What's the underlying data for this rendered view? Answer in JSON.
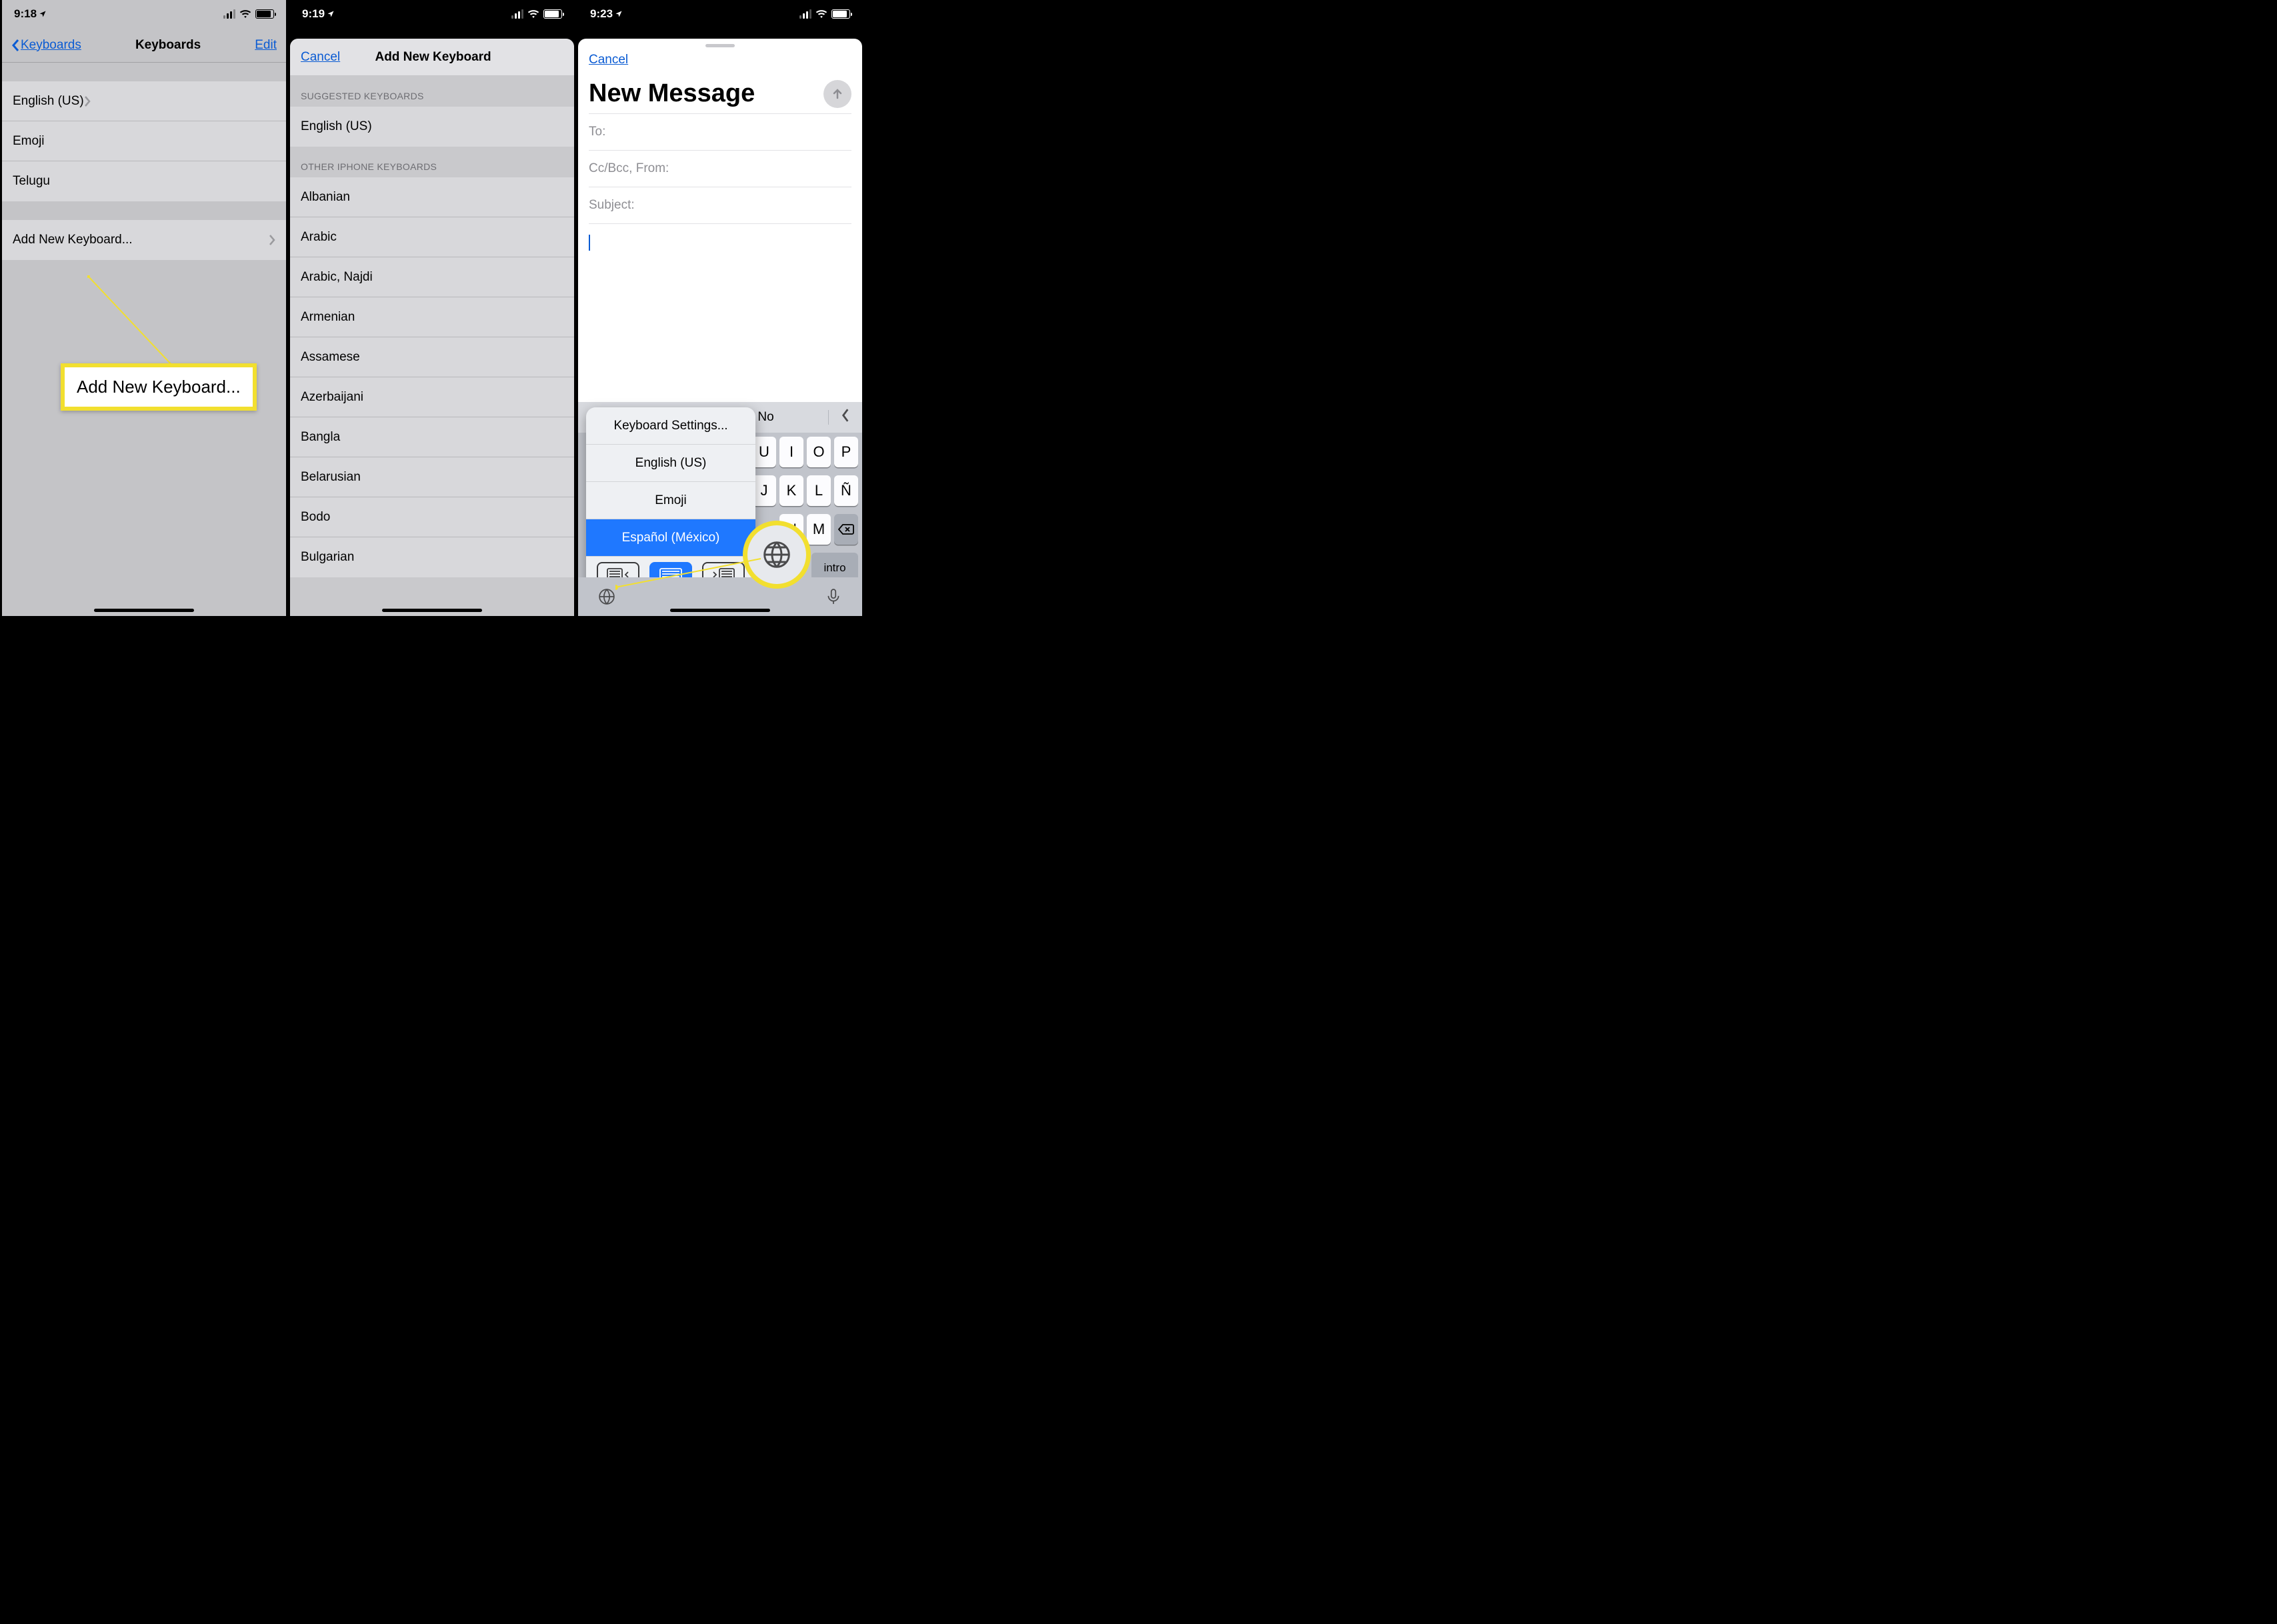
{
  "screen1": {
    "time": "9:18",
    "back_label": "Keyboards",
    "title": "Keyboards",
    "edit": "Edit",
    "keyboards": [
      "English (US)",
      "Emoji",
      "Telugu"
    ],
    "add_row": "Add New Keyboard...",
    "callout": "Add New Keyboard..."
  },
  "screen2": {
    "time": "9:19",
    "cancel": "Cancel",
    "title": "Add New Keyboard",
    "suggested_header": "SUGGESTED KEYBOARDS",
    "suggested": [
      "English (US)"
    ],
    "other_header": "OTHER IPHONE KEYBOARDS",
    "other": [
      "Albanian",
      "Arabic",
      "Arabic, Najdi",
      "Armenian",
      "Assamese",
      "Azerbaijani",
      "Bangla",
      "Belarusian",
      "Bodo",
      "Bulgarian"
    ]
  },
  "screen3": {
    "time": "9:23",
    "cancel": "Cancel",
    "title": "New Message",
    "to": "To:",
    "ccbcc": "Cc/Bcc, From:",
    "subject": "Subject:",
    "prediction_center": "No",
    "popover": {
      "settings": "Keyboard Settings...",
      "english": "English (US)",
      "emoji": "Emoji",
      "selected": "Español (México)"
    },
    "keys_row1": [
      "U",
      "I",
      "O",
      "P"
    ],
    "keys_row2": [
      "J",
      "K",
      "L",
      "Ñ"
    ],
    "keys_row3": [
      "N",
      "M"
    ],
    "intro": "intro"
  }
}
